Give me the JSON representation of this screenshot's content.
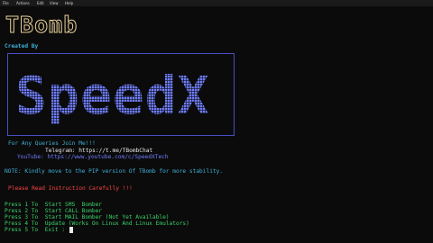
{
  "menubar": {
    "items": [
      "File",
      "Actions",
      "Edit",
      "View",
      "Help"
    ]
  },
  "ascii_title": "TBomb",
  "created_by": "Created By",
  "logo_text": "SpeedX",
  "queries": "For Any Queries Join Me!!!",
  "telegram": "Telegram: https://t.me/TBombChat",
  "youtube": "YouTube: https://www.youtube.com/c/SpeedXTech",
  "note": "NOTE: Kindly move to the PIP version Of TBomb for more stability.",
  "instruction": "Please Read Instruction Carefully !!!",
  "options": [
    "Press 1 To  Start SMS  Bomber",
    "Press 2 To  Start CALL Bomber",
    "Press 3 To  Start MAIL Bomber (Not Yet Available)",
    "Press 4 To  Update (Works On Linux And Linux Emulators)",
    "Press 5 To  Exit"
  ],
  "prompt": "Press 5 To  Exit :",
  "colors": {
    "blue": "#6f7dff",
    "red": "#ff4444",
    "green": "#3ad36a",
    "ascii": "#e8cf98"
  }
}
